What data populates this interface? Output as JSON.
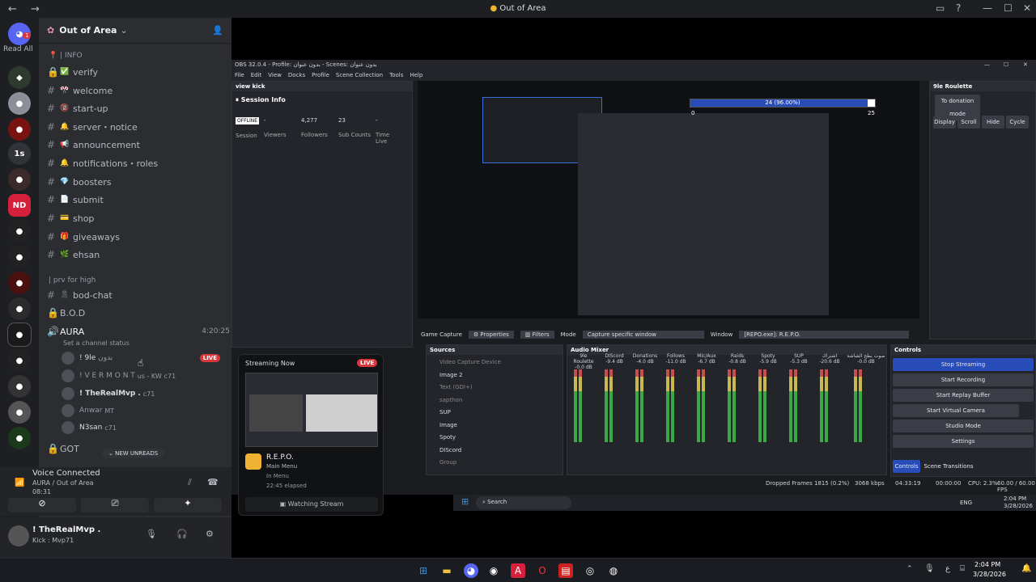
{
  "titlebar": {
    "title": "Out of Area"
  },
  "rail": {
    "read_all": "Read All",
    "badge1": "1",
    "srv_1s": "1s",
    "srv_nd": "ND"
  },
  "server": {
    "name": "Out of Area"
  },
  "categories": [
    {
      "label": "| INFO"
    },
    {
      "label": "| prv for high"
    }
  ],
  "channels": [
    {
      "name": "verify",
      "emoji": "✅",
      "locked": true
    },
    {
      "name": "welcome",
      "emoji": "🎌"
    },
    {
      "name": "start-up",
      "emoji": "🔞"
    },
    {
      "name": "server・notice",
      "emoji": "🔔"
    },
    {
      "name": "announcement",
      "emoji": "📢"
    },
    {
      "name": "notifications・roles",
      "emoji": "🔔"
    },
    {
      "name": "boosters",
      "emoji": "💎"
    },
    {
      "name": "submit",
      "emoji": "📄"
    },
    {
      "name": "shop",
      "emoji": "💳"
    },
    {
      "name": "giveaways",
      "emoji": "🎁"
    },
    {
      "name": "ehsan",
      "emoji": "🌿"
    }
  ],
  "private_channels": [
    {
      "name": "bod-chat",
      "emoji": "🎗"
    }
  ],
  "voice_channels": [
    {
      "name": "B.O.D"
    },
    {
      "name": "AURA",
      "time": "4:20:25",
      "status": "Set a channel status"
    }
  ],
  "voice_users": [
    {
      "name": "! 9le",
      "tag": "بدون",
      "live": "LIVE"
    },
    {
      "name": "! V E R M O N T",
      "tag": "us - KW",
      "badge": "c71"
    },
    {
      "name": "! TheRealMvp .",
      "badge": "c71"
    },
    {
      "name": "Anwar",
      "tag": "MT"
    },
    {
      "name": "N3san",
      "badge": "c71"
    }
  ],
  "more_channels": [
    {
      "name": "GOT"
    }
  ],
  "new_unreads": "NEW UNREADS",
  "voice": {
    "status": "Voice Connected",
    "channel": "AURA / Out of Area",
    "time": "08:31"
  },
  "user": {
    "name": "! TheRealMvp .",
    "status": "Kick : Mvp71"
  },
  "obs": {
    "title": "OBS 32.0.4 - Profile: بدون عنوان - Scenes: بدون عنوان",
    "menu": [
      "File",
      "Edit",
      "View",
      "Docks",
      "Profile",
      "Scene Collection",
      "Tools",
      "Help"
    ],
    "dock_title": "view kick",
    "session_info": "Session Info",
    "stats": [
      {
        "value": "OFFLINE",
        "label": "Session"
      },
      {
        "value": "-",
        "label": "Viewers"
      },
      {
        "value": "4,277",
        "label": "Followers"
      },
      {
        "value": "23",
        "label": "Sub Counts"
      },
      {
        "value": "-",
        "label": "Time Live"
      }
    ],
    "roulette": {
      "title": "9le Roulette",
      "donation_mode": "To donation mode",
      "buttons": [
        "Display",
        "Scroll",
        "Hide",
        "Cycle"
      ]
    },
    "progress": {
      "label": "24 (96.00%)",
      "value": 0.96,
      "min": "0",
      "max": "25"
    },
    "capture_bar": {
      "source": "Game Capture",
      "properties": "Properties",
      "filters": "Filters",
      "mode_label": "Mode",
      "mode_value": "Capture specific window",
      "window_label": "Window",
      "window_value": "[REPO.exe]: R.E.P.O."
    },
    "sources_title": "Sources",
    "sources": [
      "Video Capture Device",
      "Image 2",
      "Text (GDI+)",
      "sapthon",
      "SUP",
      "Image",
      "Spoty",
      "DIScord",
      "Group"
    ],
    "mixer_title": "Audio Mixer",
    "mixer": [
      {
        "name": "9le Roulette",
        "db": "-0.0 dB"
      },
      {
        "name": "DIScord",
        "db": "-9.4 dB"
      },
      {
        "name": "Donations",
        "db": "-4.0 dB"
      },
      {
        "name": "Follows",
        "db": "-11.0 dB"
      },
      {
        "name": "Mic/Aux",
        "db": "-6.7 dB"
      },
      {
        "name": "Raids",
        "db": "-0.8 dB"
      },
      {
        "name": "Spoty",
        "db": "-5.9 dB"
      },
      {
        "name": "SUP",
        "db": "-5.3 dB"
      },
      {
        "name": "اشتراك",
        "db": "-20.6 dB"
      },
      {
        "name": "صوت بطح الشاشة",
        "db": "-0.0 dB"
      }
    ],
    "controls_title": "Controls",
    "controls": [
      "Stop Streaming",
      "Start Recording",
      "Start Replay Buffer",
      "Start Virtual Camera",
      "Studio Mode",
      "Settings"
    ],
    "tabs": [
      "Controls",
      "Scene Transitions"
    ],
    "status": {
      "dropped": "Dropped Frames 1815 (0.2%)",
      "kbps": "3068 kbps",
      "live_time": "04:33:19",
      "rec_time": "00:00:00",
      "cpu": "CPU: 2.3%",
      "fps": "60.00 / 60.00 FPS"
    }
  },
  "popup": {
    "header": "Streaming Now",
    "live": "LIVE",
    "game": "R.E.P.O.",
    "line1": "Main Menu",
    "line2": "In Menu",
    "elapsed": "22:45 elapsed",
    "watch": "Watching Stream"
  },
  "inner_taskbar": {
    "search": "Search",
    "lang": "ENG",
    "time": "2:04 PM",
    "date": "3/28/2026"
  },
  "taskbar": {
    "lang": "ع",
    "time": "2:04 PM",
    "date": "3/28/2026"
  }
}
